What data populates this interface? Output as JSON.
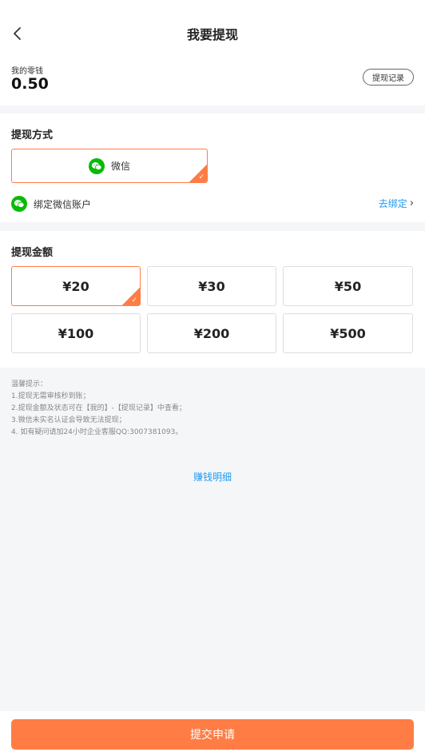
{
  "header": {
    "title": "我要提现",
    "back_icon": "chevron-left-icon"
  },
  "balance": {
    "label": "我的零钱",
    "value": "0.50",
    "record_button": "提现记录"
  },
  "method": {
    "title": "提现方式",
    "option_label": "微信",
    "option_icon": "wechat-icon",
    "bind_label": "绑定微信账户",
    "bind_link": "去绑定"
  },
  "amount": {
    "title": "提现金额",
    "options": [
      "¥20",
      "¥30",
      "¥50",
      "¥100",
      "¥200",
      "¥500"
    ],
    "selected_index": 0
  },
  "tips": {
    "lines": [
      "温馨提示：",
      "1.提现无需审核秒到账；",
      "2.提现金额及状态可在【我的】-【提现记录】中查看；",
      "3.微信未实名认证会导致无法提现；",
      "4. 如有疑问请加24小时企业客服QQ:3007381093。"
    ]
  },
  "earn_link": "赚钱明细",
  "submit_label": "提交申请",
  "colors": {
    "accent": "#ff7d45",
    "link": "#1e9bf0",
    "wechat": "#09bb07"
  }
}
